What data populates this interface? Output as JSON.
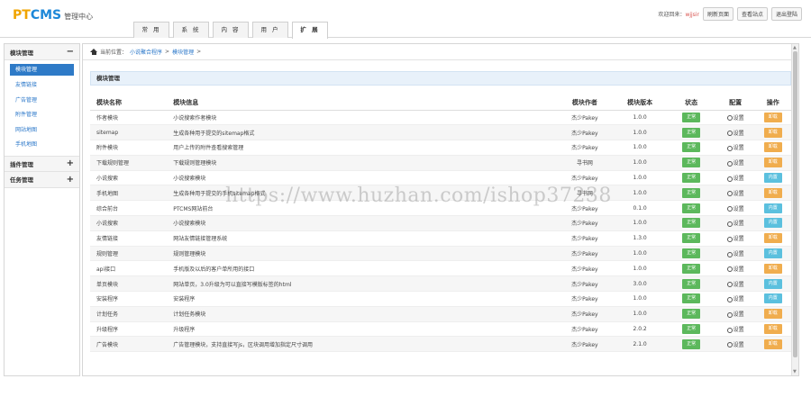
{
  "header": {
    "logo_pt": "PT",
    "logo_cms": "CMS",
    "logo_sub": "管理中心",
    "welcome": "欢迎回来：",
    "username": "wjjsir",
    "buttons": [
      "刷新页面",
      "查看站点",
      "退出登陆"
    ]
  },
  "nav": {
    "tabs": [
      "常 用",
      "系 统",
      "内 容",
      "用 户",
      "扩 展"
    ],
    "active_index": 4
  },
  "sidebar": {
    "groups": [
      {
        "title": "模块管理",
        "toggle": "−",
        "items": [
          "模块管理",
          "友情链接",
          "广告管理",
          "附件管理",
          "网站地图",
          "手机地图"
        ],
        "active": 0
      },
      {
        "title": "插件管理",
        "toggle": "+",
        "items": []
      },
      {
        "title": "任务管理",
        "toggle": "+",
        "items": []
      }
    ]
  },
  "breadcrumb": {
    "prefix": "当前位置：",
    "items": [
      "小说聚合程序",
      "模块管理"
    ],
    "sep": " > ",
    "tail": " >"
  },
  "panel_title": "模块管理",
  "table": {
    "headers": [
      "模块名称",
      "模块信息",
      "模块作者",
      "模块版本",
      "状态",
      "配置",
      "操作"
    ],
    "status_label": "正常",
    "setting_label": "设置",
    "rows": [
      {
        "name": "作者模块",
        "info": "小说搜索作者模块",
        "author": "杰少Pakey",
        "version": "1.0.0",
        "op": "卸载",
        "op_type": "uninst"
      },
      {
        "name": "sitemap",
        "info": "生成各种用于提交的sitemap格式",
        "author": "杰少Pakey",
        "version": "1.0.0",
        "op": "卸载",
        "op_type": "uninst"
      },
      {
        "name": "附件模块",
        "info": "用户上传的附件查看搜索管理",
        "author": "杰少Pakey",
        "version": "1.0.0",
        "op": "卸载",
        "op_type": "uninst"
      },
      {
        "name": "下载规则管理",
        "info": "下载规则管理模块",
        "author": "寻书网",
        "version": "1.0.0",
        "op": "卸载",
        "op_type": "uninst"
      },
      {
        "name": "小说搜索",
        "info": "小说搜索模块",
        "author": "杰少Pakey",
        "version": "1.0.0",
        "op": "内置",
        "op_type": "builtin"
      },
      {
        "name": "手机地图",
        "info": "生成各种用于提交的手机sitemap格式",
        "author": "寻书网",
        "version": "1.0.0",
        "op": "卸载",
        "op_type": "uninst"
      },
      {
        "name": "综合前台",
        "info": "PTCMS网站前台",
        "author": "杰少Pakey",
        "version": "0.1.0",
        "op": "内置",
        "op_type": "builtin"
      },
      {
        "name": "小说搜索",
        "info": "小说搜索模块",
        "author": "杰少Pakey",
        "version": "1.0.0",
        "op": "内置",
        "op_type": "builtin"
      },
      {
        "name": "友情链接",
        "info": "网站友情链接管理系统",
        "author": "杰少Pakey",
        "version": "1.3.0",
        "op": "卸载",
        "op_type": "uninst"
      },
      {
        "name": "规则管理",
        "info": "规则管理模块",
        "author": "杰少Pakey",
        "version": "1.0.0",
        "op": "内置",
        "op_type": "builtin"
      },
      {
        "name": "api接口",
        "info": "手机版及以后的客户单所用的接口",
        "author": "杰少Pakey",
        "version": "1.0.0",
        "op": "卸载",
        "op_type": "uninst"
      },
      {
        "name": "单页模块",
        "info": "网站单页，3.0升级为可以直接写模版标签的html",
        "author": "杰少Pakey",
        "version": "3.0.0",
        "op": "内置",
        "op_type": "builtin"
      },
      {
        "name": "安装程序",
        "info": "安装程序",
        "author": "杰少Pakey",
        "version": "1.0.0",
        "op": "内置",
        "op_type": "builtin"
      },
      {
        "name": "计划任务",
        "info": "计划任务模块",
        "author": "杰少Pakey",
        "version": "1.0.0",
        "op": "卸载",
        "op_type": "uninst"
      },
      {
        "name": "升级程序",
        "info": "升级程序",
        "author": "杰少Pakey",
        "version": "2.0.2",
        "op": "卸载",
        "op_type": "uninst"
      },
      {
        "name": "广告模块",
        "info": "广告管理模块，支持直接写js，区块调用增加指定尺寸调用",
        "author": "杰少Pakey",
        "version": "2.1.0",
        "op": "卸载",
        "op_type": "uninst"
      }
    ]
  },
  "watermark": "https://www.huzhan.com/ishop37238",
  "colors": {
    "status_green": "#5cb85c",
    "uninstall_orange": "#f0ad4e",
    "builtin_blue": "#5bc0de",
    "sidebar_active": "#2e7ac7",
    "logo_orange": "#f0a400",
    "logo_blue": "#1e88d8"
  }
}
